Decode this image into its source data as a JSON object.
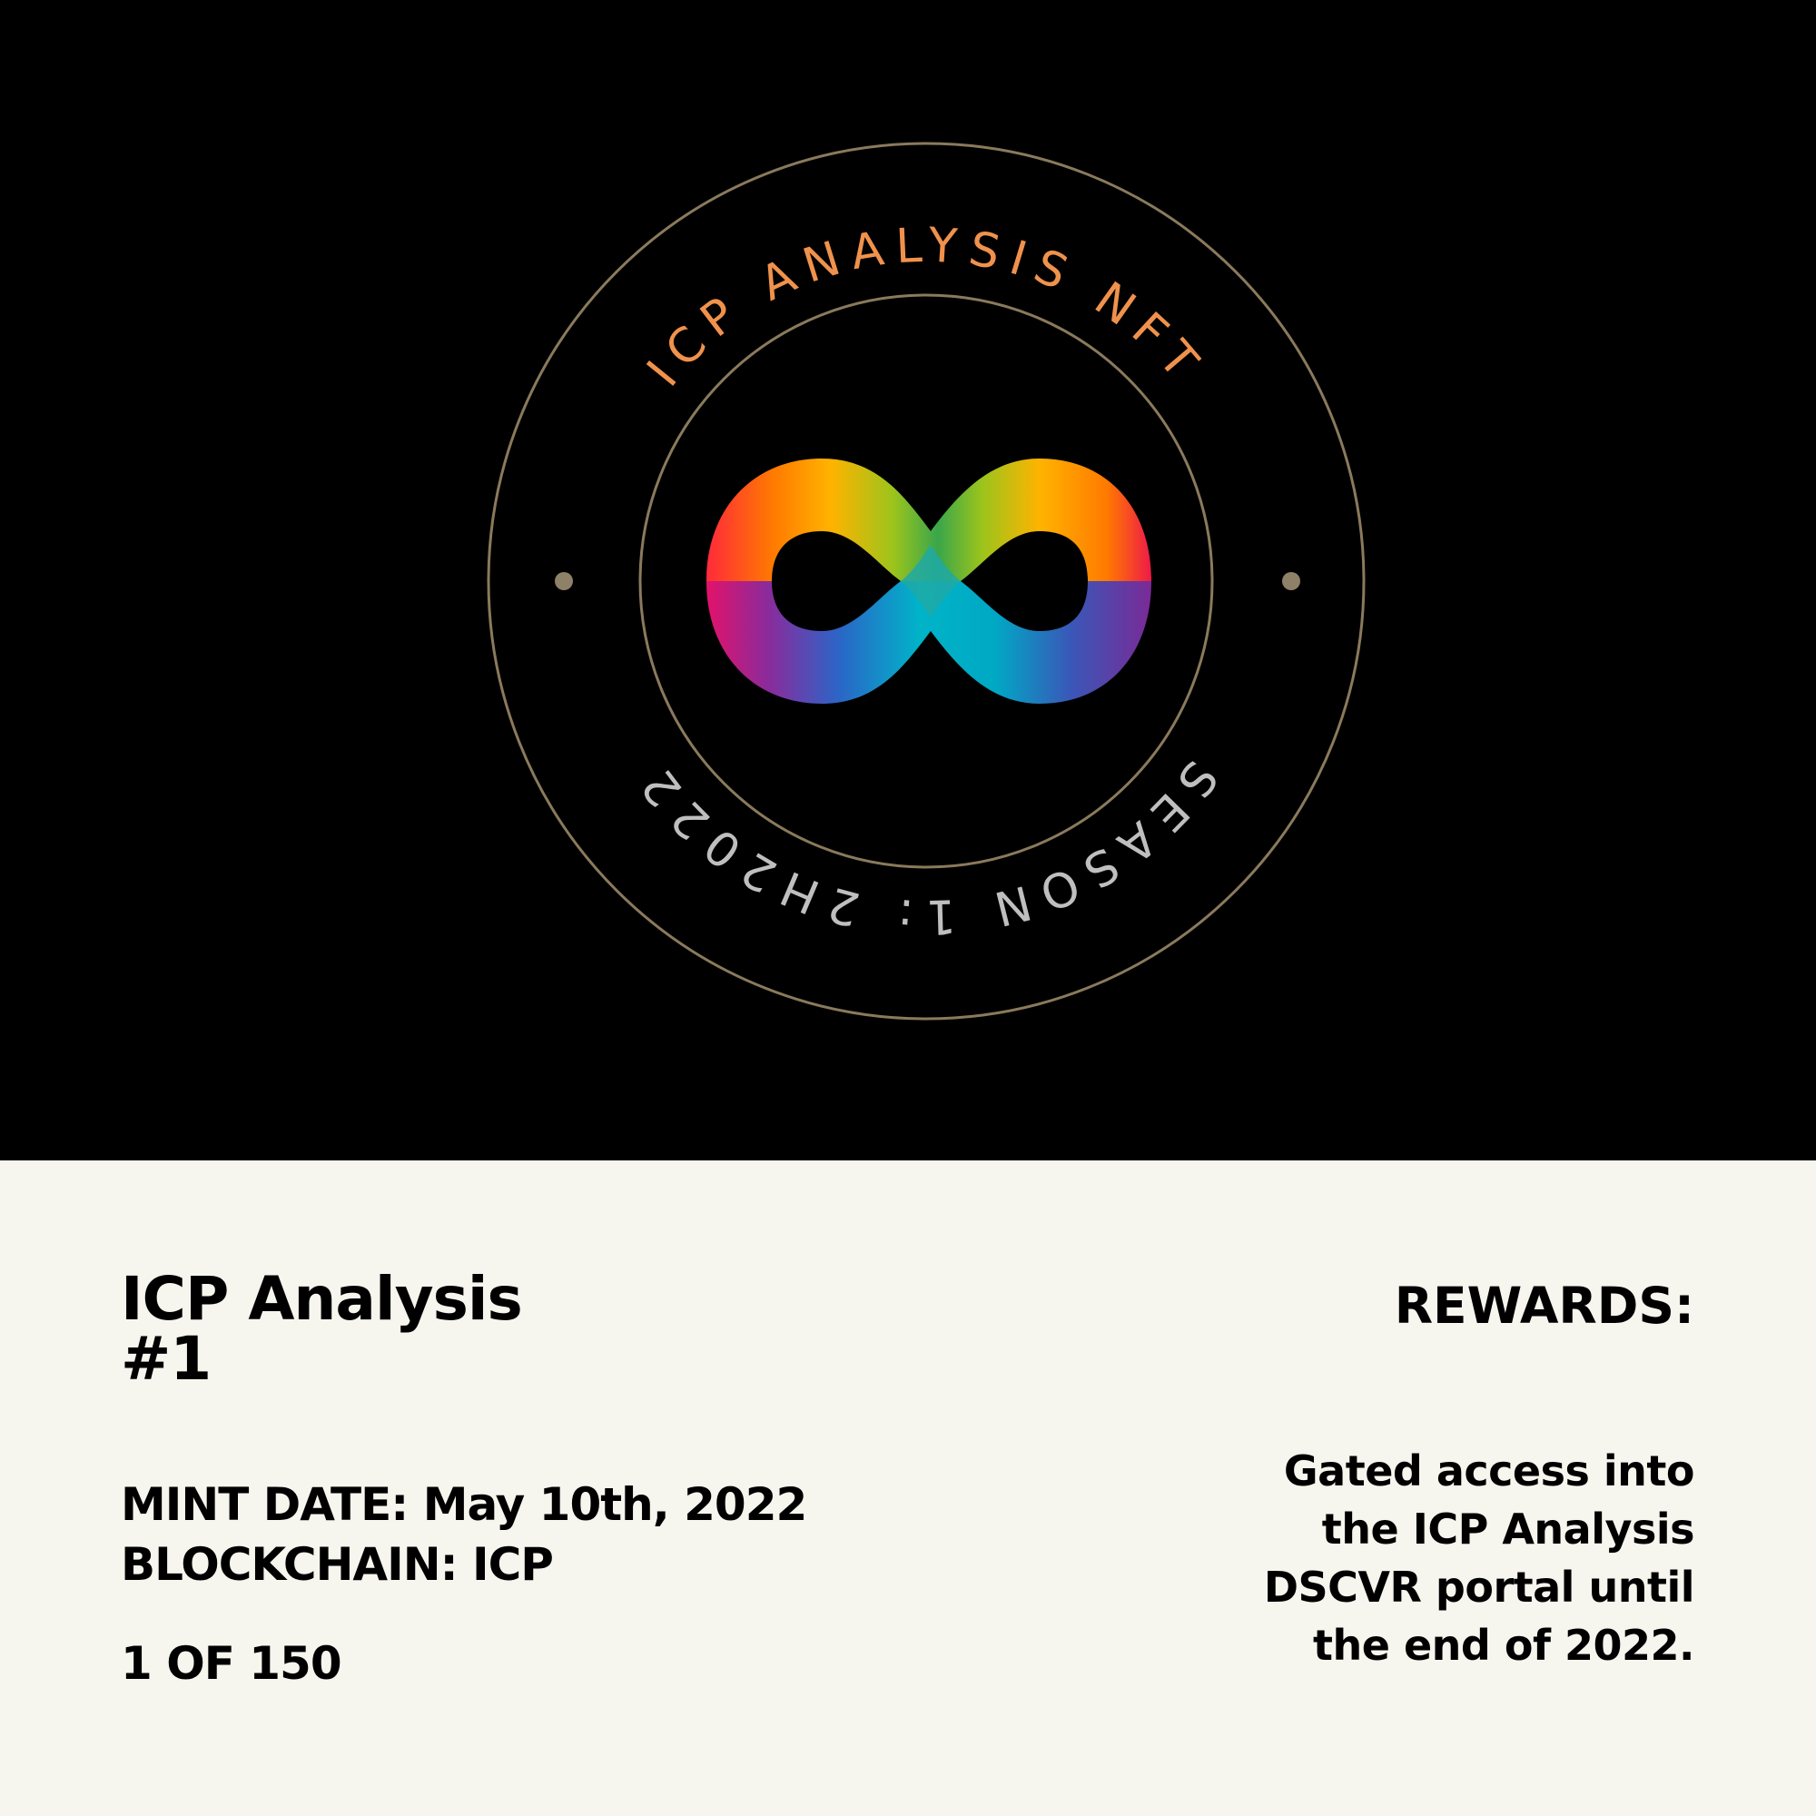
{
  "artwork": {
    "ring_top_text": "ICP ANALYSIS NFT",
    "ring_bottom_text": "SEASON 1: 2H2022",
    "logo": "infinity-icon",
    "colors": {
      "background": "#000000",
      "ring": "#8a7a5c",
      "dot": "#8f8068",
      "top_text": "#f0924c",
      "bottom_text": "#bfbfbf"
    }
  },
  "info": {
    "title_line1": "ICP Analysis",
    "title_line2": "#1",
    "mint_date": "MINT DATE: May 10th, 2022",
    "blockchain": "BLOCKCHAIN: ICP",
    "edition": "1 OF 150",
    "rewards_heading": "REWARDS:",
    "rewards_lines": [
      "Gated access into",
      "the ICP Analysis",
      "DSCVR portal until",
      "the end of 2022."
    ],
    "colors": {
      "panel_background": "#f6f5ee",
      "text": "#000000"
    }
  }
}
